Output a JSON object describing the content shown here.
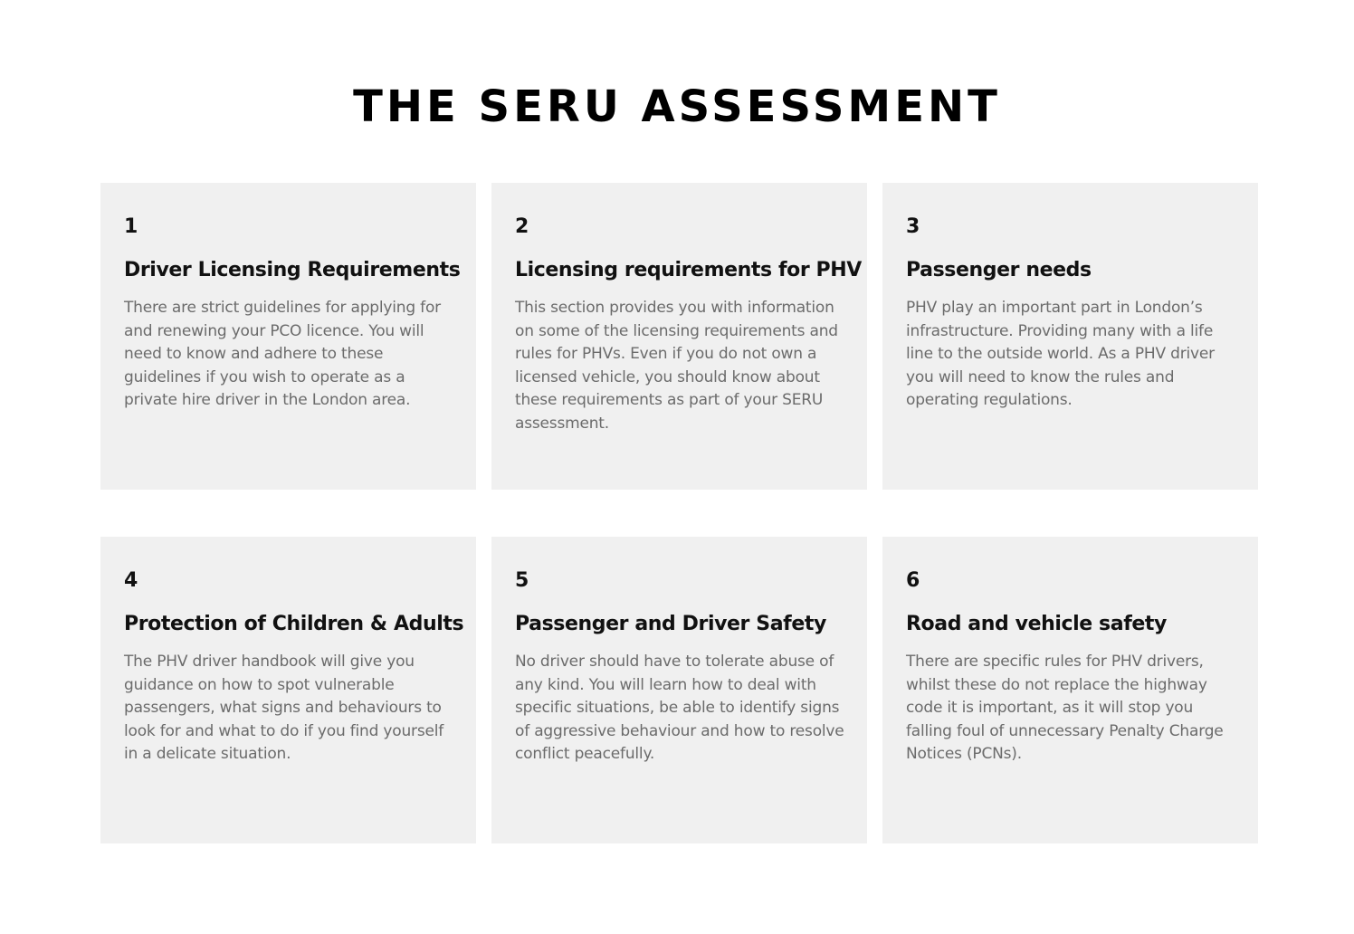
{
  "page": {
    "title": "THE SERU ASSESSMENT"
  },
  "colors": {
    "card_background": "#f0f0f0",
    "title_text": "#000000",
    "body_text": "#6b6b6b"
  },
  "cards": [
    {
      "number": "1",
      "title": "Driver Licensing Requirements",
      "body": "There are strict guidelines for applying for and renewing your PCO licence. You will need to know and adhere to these guidelines if you wish to operate as a private hire driver in the London area."
    },
    {
      "number": "2",
      "title": "Licensing requirements for PHV",
      "body": "This section provides you with information on some of the licensing requirements and rules for PHVs. Even if you do not own a licensed vehicle, you should know about these requirements as part of your SERU assessment."
    },
    {
      "number": "3",
      "title": "Passenger needs",
      "body": "PHV play an important part in London’s infrastructure. Providing many with a life line to the outside world. As a PHV driver you will need to know the rules and operating regulations."
    },
    {
      "number": "4",
      "title": "Protection of Children & Adults",
      "body": "The PHV driver handbook will give you guidance on how to spot vulnerable passengers, what signs and behaviours to look for and what to do if you find yourself in a delicate situation."
    },
    {
      "number": "5",
      "title": "Passenger and Driver Safety",
      "body": "No driver should have to tolerate abuse of any kind. You will learn how to deal with specific situations, be able to identify signs of aggressive behaviour and how to resolve conflict peacefully."
    },
    {
      "number": "6",
      "title": "Road and vehicle safety",
      "body": "There are specific rules for PHV drivers, whilst these do not replace the highway code it is important, as it will stop you falling foul of unnecessary Penalty Charge Notices (PCNs)."
    }
  ]
}
